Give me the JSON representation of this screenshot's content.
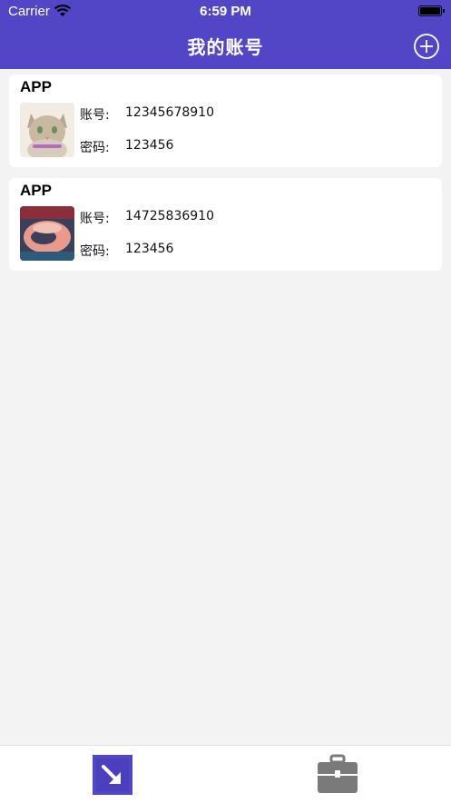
{
  "status_bar": {
    "carrier": "Carrier",
    "time": "6:59 PM"
  },
  "header": {
    "title": "我的账号"
  },
  "accounts": [
    {
      "app": "APP",
      "account_label": "账号:",
      "account": "12345678910",
      "password_label": "密码:",
      "password": "123456"
    },
    {
      "app": "APP",
      "account_label": "账号:",
      "account": "14725836910",
      "password_label": "密码:",
      "password": "123456"
    }
  ],
  "colors": {
    "accent": "#5146c6",
    "background": "#f3f3f3",
    "tab_inactive": "#7a7a7a"
  },
  "icons": {
    "add": "plus-circle-icon",
    "tab1": "import-arrow-icon",
    "tab2": "briefcase-icon"
  }
}
